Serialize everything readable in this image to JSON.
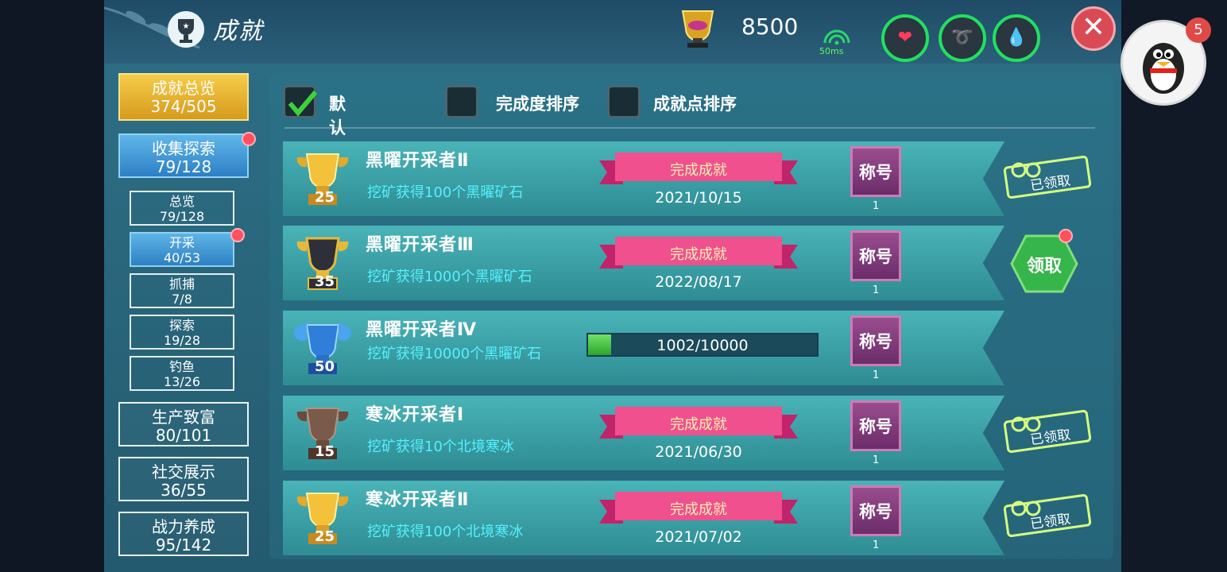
{
  "header": {
    "title": "成就",
    "points": "8500",
    "ping": "50ms",
    "close_label": "✕"
  },
  "left_nav": {
    "overview": {
      "label": "成就总览",
      "progress": "374/505"
    },
    "collect": {
      "label": "收集探索",
      "progress": "79/128"
    },
    "sub_items": [
      {
        "label": "总览",
        "progress": "79/128"
      },
      {
        "label": "开采",
        "progress": "40/53"
      },
      {
        "label": "抓捕",
        "progress": "7/8"
      },
      {
        "label": "探索",
        "progress": "19/28"
      },
      {
        "label": "钓鱼",
        "progress": "13/26"
      }
    ],
    "produce": {
      "label": "生产致富",
      "progress": "80/101"
    },
    "social": {
      "label": "社交展示",
      "progress": "36/55"
    },
    "power": {
      "label": "战力养成",
      "progress": "95/142"
    }
  },
  "sort": {
    "default": "默认排序",
    "completion": "完成度排序",
    "points": "成就点排序"
  },
  "achievements": [
    {
      "name": "黑曜开采者Ⅱ",
      "points": "25",
      "desc": "挖矿获得100个黑曜矿石",
      "status": "完成成就",
      "date": "2021/10/15",
      "title_label": "称号",
      "title_count": "1",
      "claim": "已领取"
    },
    {
      "name": "黑曜开采者Ⅲ",
      "points": "35",
      "desc": "挖矿获得1000个黑曜矿石",
      "status": "完成成就",
      "date": "2022/08/17",
      "title_label": "称号",
      "title_count": "1",
      "claim": "领取"
    },
    {
      "name": "黑曜开采者Ⅳ",
      "points": "50",
      "desc": "挖矿获得10000个黑曜矿石",
      "progress_text": "1002/10000",
      "progress_fraction": 0.1002,
      "title_label": "称号",
      "title_count": "1"
    },
    {
      "name": "寒冰开采者Ⅰ",
      "points": "15",
      "desc": "挖矿获得10个北境寒冰",
      "status": "完成成就",
      "date": "2021/06/30",
      "title_label": "称号",
      "title_count": "1",
      "claim": "已领取"
    },
    {
      "name": "寒冰开采者Ⅱ",
      "points": "25",
      "desc": "挖矿获得100个北境寒冰",
      "status": "完成成就",
      "date": "2021/07/02",
      "title_label": "称号",
      "title_count": "1",
      "claim": "已领取"
    }
  ],
  "notification": {
    "count": "5"
  },
  "colors": {
    "accent_green": "#20e060",
    "desc_cyan": "#54f0ff",
    "claim_red": "#ff5060"
  }
}
